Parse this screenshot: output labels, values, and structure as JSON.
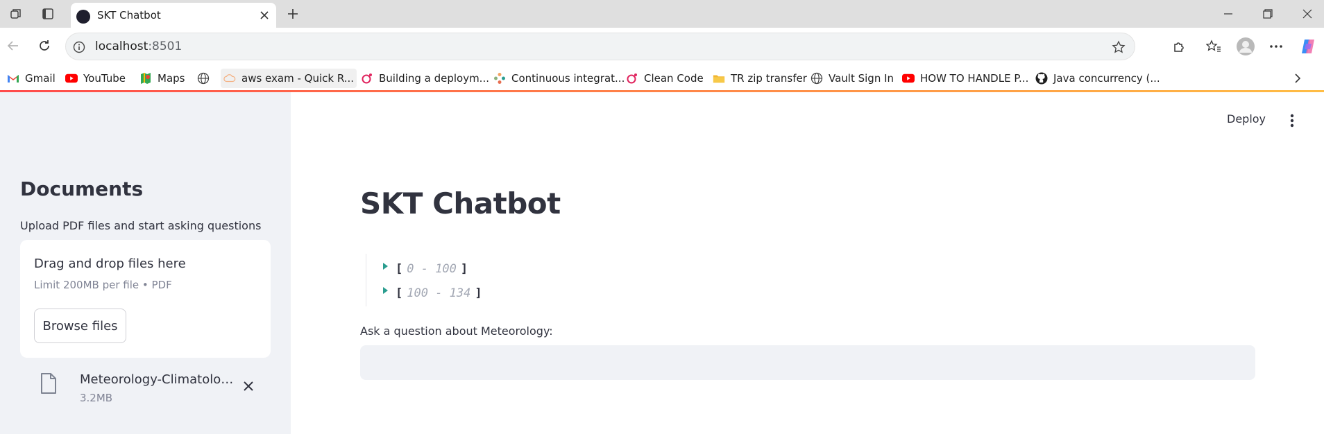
{
  "browser": {
    "tab": {
      "title": "SKT Chatbot"
    },
    "address_bar": {
      "host": "localhost",
      "port": ":8501"
    },
    "bookmarks": [
      {
        "label": "Gmail",
        "icon": "gmail-icon"
      },
      {
        "label": "YouTube",
        "icon": "youtube-icon"
      },
      {
        "label": "Maps",
        "icon": "maps-icon"
      },
      {
        "label": "",
        "icon": "globe-icon"
      },
      {
        "label": "aws exam - Quick R...",
        "icon": "cloud-icon"
      },
      {
        "label": "Building a deploym...",
        "icon": "opera-icon"
      },
      {
        "label": "Continuous integrat...",
        "icon": "gear-flower-icon"
      },
      {
        "label": "Clean Code",
        "icon": "opera-icon"
      },
      {
        "label": "TR zip transfer",
        "icon": "folder-icon"
      },
      {
        "label": "Vault Sign In",
        "icon": "globe-icon"
      },
      {
        "label": "HOW TO HANDLE P...",
        "icon": "youtube-icon"
      },
      {
        "label": "Java concurrency (...",
        "icon": "github-icon"
      }
    ]
  },
  "sidebar": {
    "title": "Documents",
    "subtitle": "Upload PDF files and start asking questions",
    "dropzone": {
      "title": "Drag and drop files here",
      "limit": "Limit 200MB per file • PDF",
      "browse_label": "Browse files"
    },
    "file": {
      "name": "Meteorology-Climatology.pdf",
      "size": "3.2MB"
    }
  },
  "main": {
    "deploy_label": "Deploy",
    "title": "SKT Chatbot",
    "json_ranges": [
      "0 - 100",
      "100 - 134"
    ],
    "question_label": "Ask a question about Meteorology:",
    "question_value": ""
  },
  "colors": {
    "accent": "#ff4b4b",
    "sidebar_bg": "#f0f2f6",
    "caret": "#2a9d8f"
  }
}
